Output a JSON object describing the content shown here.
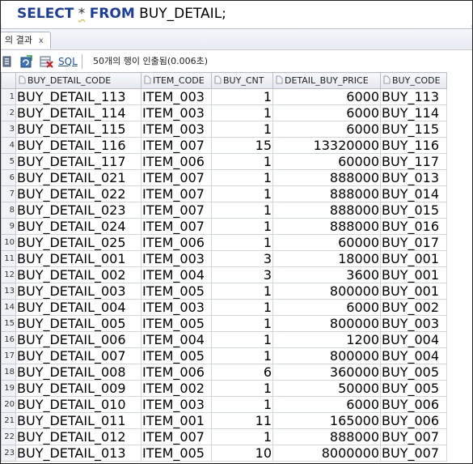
{
  "editor": {
    "select_kw": "SELECT",
    "star": "*",
    "from_kw": "FROM",
    "table_name": "BUY_DETAIL;"
  },
  "tab": {
    "label": "의 결과",
    "close": "x"
  },
  "toolbar": {
    "sql_label": "SQL",
    "status": "50개의 행이 인출됨(0.006초)",
    "icons": [
      "pin-icon",
      "refresh-icon",
      "delete-icon"
    ]
  },
  "grid": {
    "columns": [
      "BUY_DETAIL_CODE",
      "ITEM_CODE",
      "BUY_CNT",
      "DETAIL_BUY_PRICE",
      "BUY_CODE"
    ],
    "rows": [
      {
        "n": "1",
        "code": "BUY_DETAIL_113",
        "item": "ITEM_003",
        "cnt": "1",
        "price": "6000",
        "buy": "BUY_113"
      },
      {
        "n": "2",
        "code": "BUY_DETAIL_114",
        "item": "ITEM_003",
        "cnt": "1",
        "price": "6000",
        "buy": "BUY_114"
      },
      {
        "n": "3",
        "code": "BUY_DETAIL_115",
        "item": "ITEM_003",
        "cnt": "1",
        "price": "6000",
        "buy": "BUY_115"
      },
      {
        "n": "4",
        "code": "BUY_DETAIL_116",
        "item": "ITEM_007",
        "cnt": "15",
        "price": "13320000",
        "buy": "BUY_116"
      },
      {
        "n": "5",
        "code": "BUY_DETAIL_117",
        "item": "ITEM_006",
        "cnt": "1",
        "price": "60000",
        "buy": "BUY_117"
      },
      {
        "n": "6",
        "code": "BUY_DETAIL_021",
        "item": "ITEM_007",
        "cnt": "1",
        "price": "888000",
        "buy": "BUY_013"
      },
      {
        "n": "7",
        "code": "BUY_DETAIL_022",
        "item": "ITEM_007",
        "cnt": "1",
        "price": "888000",
        "buy": "BUY_014"
      },
      {
        "n": "8",
        "code": "BUY_DETAIL_023",
        "item": "ITEM_007",
        "cnt": "1",
        "price": "888000",
        "buy": "BUY_015"
      },
      {
        "n": "9",
        "code": "BUY_DETAIL_024",
        "item": "ITEM_007",
        "cnt": "1",
        "price": "888000",
        "buy": "BUY_016"
      },
      {
        "n": "10",
        "code": "BUY_DETAIL_025",
        "item": "ITEM_006",
        "cnt": "1",
        "price": "60000",
        "buy": "BUY_017"
      },
      {
        "n": "11",
        "code": "BUY_DETAIL_001",
        "item": "ITEM_003",
        "cnt": "3",
        "price": "18000",
        "buy": "BUY_001"
      },
      {
        "n": "12",
        "code": "BUY_DETAIL_002",
        "item": "ITEM_004",
        "cnt": "3",
        "price": "3600",
        "buy": "BUY_001"
      },
      {
        "n": "13",
        "code": "BUY_DETAIL_003",
        "item": "ITEM_005",
        "cnt": "1",
        "price": "800000",
        "buy": "BUY_001"
      },
      {
        "n": "14",
        "code": "BUY_DETAIL_004",
        "item": "ITEM_003",
        "cnt": "1",
        "price": "6000",
        "buy": "BUY_002"
      },
      {
        "n": "15",
        "code": "BUY_DETAIL_005",
        "item": "ITEM_005",
        "cnt": "1",
        "price": "800000",
        "buy": "BUY_003"
      },
      {
        "n": "16",
        "code": "BUY_DETAIL_006",
        "item": "ITEM_004",
        "cnt": "1",
        "price": "1200",
        "buy": "BUY_004"
      },
      {
        "n": "17",
        "code": "BUY_DETAIL_007",
        "item": "ITEM_005",
        "cnt": "1",
        "price": "800000",
        "buy": "BUY_004"
      },
      {
        "n": "18",
        "code": "BUY_DETAIL_008",
        "item": "ITEM_006",
        "cnt": "6",
        "price": "360000",
        "buy": "BUY_005"
      },
      {
        "n": "19",
        "code": "BUY_DETAIL_009",
        "item": "ITEM_002",
        "cnt": "1",
        "price": "50000",
        "buy": "BUY_005"
      },
      {
        "n": "20",
        "code": "BUY_DETAIL_010",
        "item": "ITEM_003",
        "cnt": "1",
        "price": "6000",
        "buy": "BUY_006"
      },
      {
        "n": "21",
        "code": "BUY_DETAIL_011",
        "item": "ITEM_001",
        "cnt": "11",
        "price": "165000",
        "buy": "BUY_006"
      },
      {
        "n": "22",
        "code": "BUY_DETAIL_012",
        "item": "ITEM_007",
        "cnt": "1",
        "price": "888000",
        "buy": "BUY_007"
      },
      {
        "n": "23",
        "code": "BUY_DETAIL_013",
        "item": "ITEM_005",
        "cnt": "10",
        "price": "8000000",
        "buy": "BUY_007"
      }
    ]
  }
}
